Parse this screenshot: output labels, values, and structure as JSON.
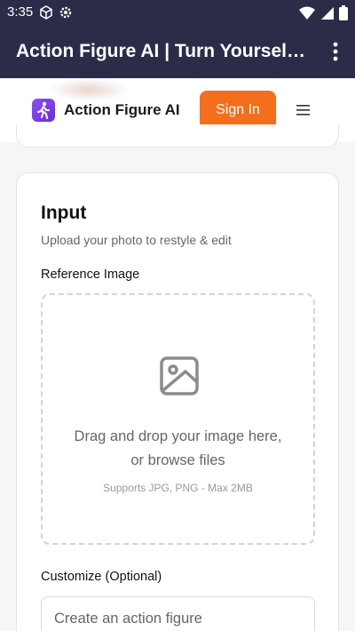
{
  "status_bar": {
    "time": "3:35",
    "left_icons": [
      "cube-icon",
      "gear-icon"
    ],
    "right_icons": [
      "wifi-icon",
      "signal-icon",
      "battery-icon"
    ]
  },
  "title_bar": {
    "title": "Action Figure AI | Turn Yoursel…",
    "menu_icon": "kebab-menu-icon"
  },
  "header": {
    "brand": "Action Figure AI",
    "sign_in_label": "Sign In",
    "menu_icon": "hamburger-icon"
  },
  "input_card": {
    "heading": "Input",
    "subtitle": "Upload your photo to restyle & edit",
    "reference_label": "Reference Image",
    "dropzone": {
      "icon": "image-icon",
      "line1": "Drag and drop your image here,",
      "line2": "or browse files",
      "hint": "Supports JPG, PNG - Max 2MB"
    },
    "customize_label": "Customize (Optional)",
    "customize_placeholder": "Create an action figure"
  },
  "colors": {
    "bar_bg": "#2b2d48",
    "accent": "#f36f1c",
    "logo": "#7b3ff2"
  }
}
